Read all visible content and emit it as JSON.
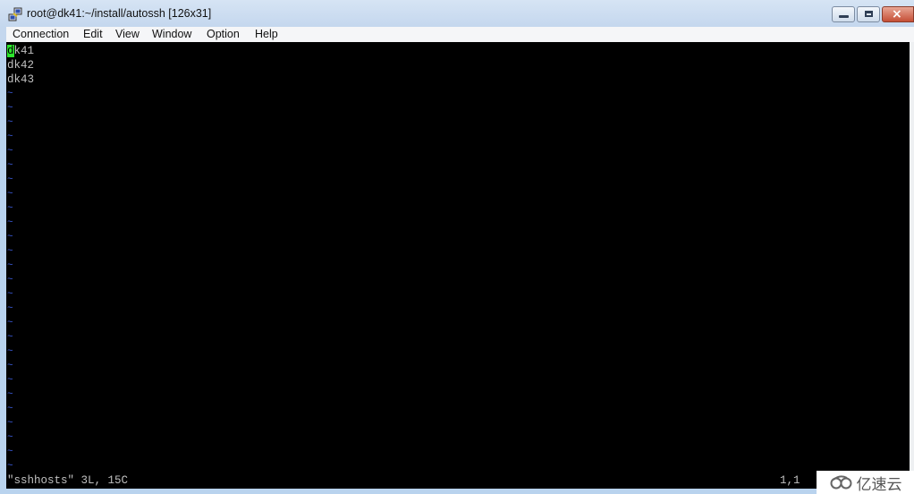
{
  "window": {
    "title": "root@dk41:~/install/autossh [126x31]",
    "icon": "putty-terminal-icon",
    "controls": {
      "minimize": "minimize",
      "maximize": "maximize",
      "close": "×"
    }
  },
  "menu": {
    "items": [
      "Connection",
      "Edit",
      "View",
      "Window",
      "Option",
      "Help"
    ]
  },
  "terminal": {
    "lines": [
      "dk41",
      "dk42",
      "dk43"
    ],
    "cursor_char": "d",
    "cursor_rest": "k41",
    "tilde": "~",
    "tilde_count": 27,
    "status_left": "\"sshhosts\" 3L, 15C",
    "status_right": "1,1",
    "colors": {
      "background": "#000000",
      "text": "#c0c0c0",
      "cursor": "#2ce62c",
      "tilde": "#3b5bdb"
    }
  },
  "watermark": {
    "text": "亿速云"
  }
}
